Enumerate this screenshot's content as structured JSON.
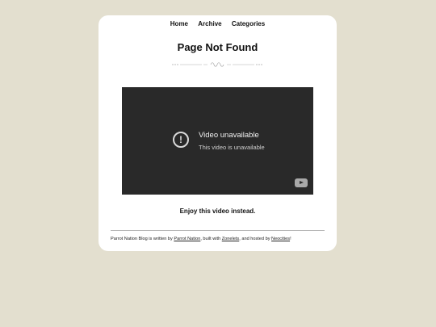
{
  "nav": {
    "items": [
      "Home",
      "Archive",
      "Categories"
    ]
  },
  "page": {
    "title": "Page Not Found",
    "caption": "Enjoy this video instead."
  },
  "video": {
    "title": "Video unavailable",
    "subtitle": "This video is unavailable",
    "alert_glyph": "!",
    "icons": [
      "alert-circle-icon",
      "youtube-logo-icon"
    ]
  },
  "footer": {
    "text_1": "Parrot Nation Blog is written by ",
    "link_author": "Parrot Nation",
    "text_2": ", built with ",
    "link_builder": "Zonelets",
    "text_3": ", and hosted by ",
    "link_host": "Neocities",
    "text_4": "!"
  },
  "colors": {
    "background": "#e3dfcf",
    "card": "#ffffff",
    "video_bg": "#292929"
  }
}
